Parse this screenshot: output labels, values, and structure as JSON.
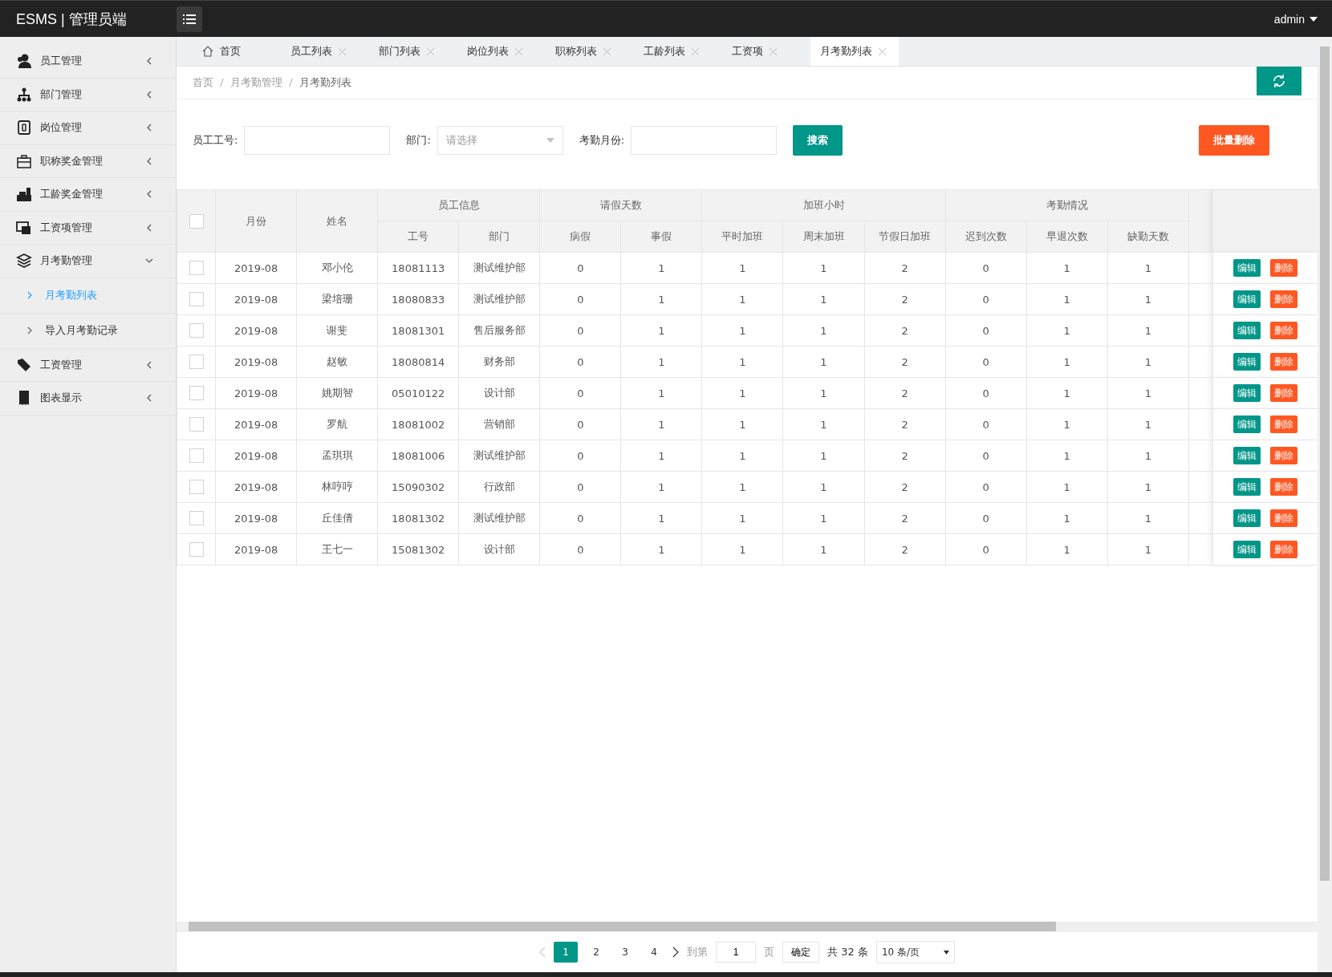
{
  "header": {
    "brand": "ESMS | 管理员端",
    "user": "admin"
  },
  "sidebar": {
    "items": [
      {
        "label": "员工管理",
        "expanded": false
      },
      {
        "label": "部门管理",
        "expanded": false
      },
      {
        "label": "岗位管理",
        "expanded": false
      },
      {
        "label": "职称奖金管理",
        "expanded": false
      },
      {
        "label": "工龄奖金管理",
        "expanded": false
      },
      {
        "label": "工资项管理",
        "expanded": false
      },
      {
        "label": "月考勤管理",
        "expanded": true,
        "children": [
          {
            "label": "月考勤列表",
            "selected": true
          },
          {
            "label": "导入月考勤记录",
            "selected": false
          }
        ]
      },
      {
        "label": "工资管理",
        "expanded": false
      },
      {
        "label": "图表显示",
        "expanded": false
      }
    ]
  },
  "tabs": [
    {
      "label": "首页",
      "kind": "home",
      "selected": false
    },
    {
      "label": "员工列表",
      "kind": "closable",
      "selected": false
    },
    {
      "label": "部门列表",
      "kind": "closable",
      "selected": false
    },
    {
      "label": "岗位列表",
      "kind": "closable",
      "selected": false
    },
    {
      "label": "职称列表",
      "kind": "closable",
      "selected": false
    },
    {
      "label": "工龄列表",
      "kind": "closable",
      "selected": false
    },
    {
      "label": "工资项",
      "kind": "closable",
      "selected": false
    },
    {
      "label": "月考勤列表",
      "kind": "closable",
      "selected": true
    }
  ],
  "breadcrumb": [
    "首页",
    "月考勤管理",
    "月考勤列表"
  ],
  "filters": {
    "employee_no_label": "员工工号:",
    "dept_label": "部门:",
    "dept_placeholder": "请选择",
    "month_label": "考勤月份:",
    "search_button": "搜索",
    "batch_delete_button": "批量删除"
  },
  "table": {
    "all_checked": false,
    "groups": [
      "员工信息",
      "请假天数",
      "加班小时",
      "考勤情况"
    ],
    "columns": [
      "月份",
      "姓名",
      "工号",
      "部门",
      "病假",
      "事假",
      "平时加班",
      "周末加班",
      "节假日加班",
      "迟到次数",
      "早退次数",
      "缺勤天数"
    ],
    "rows": [
      {
        "checked": false,
        "cells": [
          "2019-08",
          "邓小伦",
          "18081113",
          "测试维护部",
          "0",
          "1",
          "1",
          "1",
          "2",
          "0",
          "1",
          "1"
        ],
        "actions": [
          "编辑",
          "删除"
        ]
      },
      {
        "checked": false,
        "cells": [
          "2019-08",
          "梁培珊",
          "18080833",
          "测试维护部",
          "0",
          "1",
          "1",
          "1",
          "2",
          "0",
          "1",
          "1"
        ],
        "actions": [
          "编辑",
          "删除"
        ]
      },
      {
        "checked": false,
        "cells": [
          "2019-08",
          "谢斐",
          "18081301",
          "售后服务部",
          "0",
          "1",
          "1",
          "1",
          "2",
          "0",
          "1",
          "1"
        ],
        "actions": [
          "编辑",
          "删除"
        ]
      },
      {
        "checked": false,
        "cells": [
          "2019-08",
          "赵敏",
          "18080814",
          "财务部",
          "0",
          "1",
          "1",
          "1",
          "2",
          "0",
          "1",
          "1"
        ],
        "actions": [
          "编辑",
          "删除"
        ]
      },
      {
        "checked": false,
        "cells": [
          "2019-08",
          "姚期智",
          "05010122",
          "设计部",
          "0",
          "1",
          "1",
          "1",
          "2",
          "0",
          "1",
          "1"
        ],
        "actions": [
          "编辑",
          "删除"
        ]
      },
      {
        "checked": false,
        "cells": [
          "2019-08",
          "罗航",
          "18081002",
          "营销部",
          "0",
          "1",
          "1",
          "1",
          "2",
          "0",
          "1",
          "1"
        ],
        "actions": [
          "编辑",
          "删除"
        ]
      },
      {
        "checked": false,
        "cells": [
          "2019-08",
          "孟琪琪",
          "18081006",
          "测试维护部",
          "0",
          "1",
          "1",
          "1",
          "2",
          "0",
          "1",
          "1"
        ],
        "actions": [
          "编辑",
          "删除"
        ]
      },
      {
        "checked": false,
        "cells": [
          "2019-08",
          "林哼哼",
          "15090302",
          "行政部",
          "0",
          "1",
          "1",
          "1",
          "2",
          "0",
          "1",
          "1"
        ],
        "actions": [
          "编辑",
          "删除"
        ]
      },
      {
        "checked": false,
        "cells": [
          "2019-08",
          "丘佳倩",
          "18081302",
          "测试维护部",
          "0",
          "1",
          "1",
          "1",
          "2",
          "0",
          "1",
          "1"
        ],
        "actions": [
          "编辑",
          "删除"
        ]
      },
      {
        "checked": false,
        "cells": [
          "2019-08",
          "王七一",
          "15081302",
          "设计部",
          "0",
          "1",
          "1",
          "1",
          "2",
          "0",
          "1",
          "1"
        ],
        "actions": [
          "编辑",
          "删除"
        ]
      }
    ]
  },
  "pagination": {
    "pages": [
      {
        "label": "1",
        "selected": true
      },
      {
        "label": "2",
        "selected": false
      },
      {
        "label": "3",
        "selected": false
      },
      {
        "label": "4",
        "selected": false
      }
    ],
    "goto_label": "到第",
    "goto_value": "1",
    "page_unit": "页",
    "confirm": "确定",
    "total": "共 32 条",
    "page_size": "10 条/页"
  }
}
